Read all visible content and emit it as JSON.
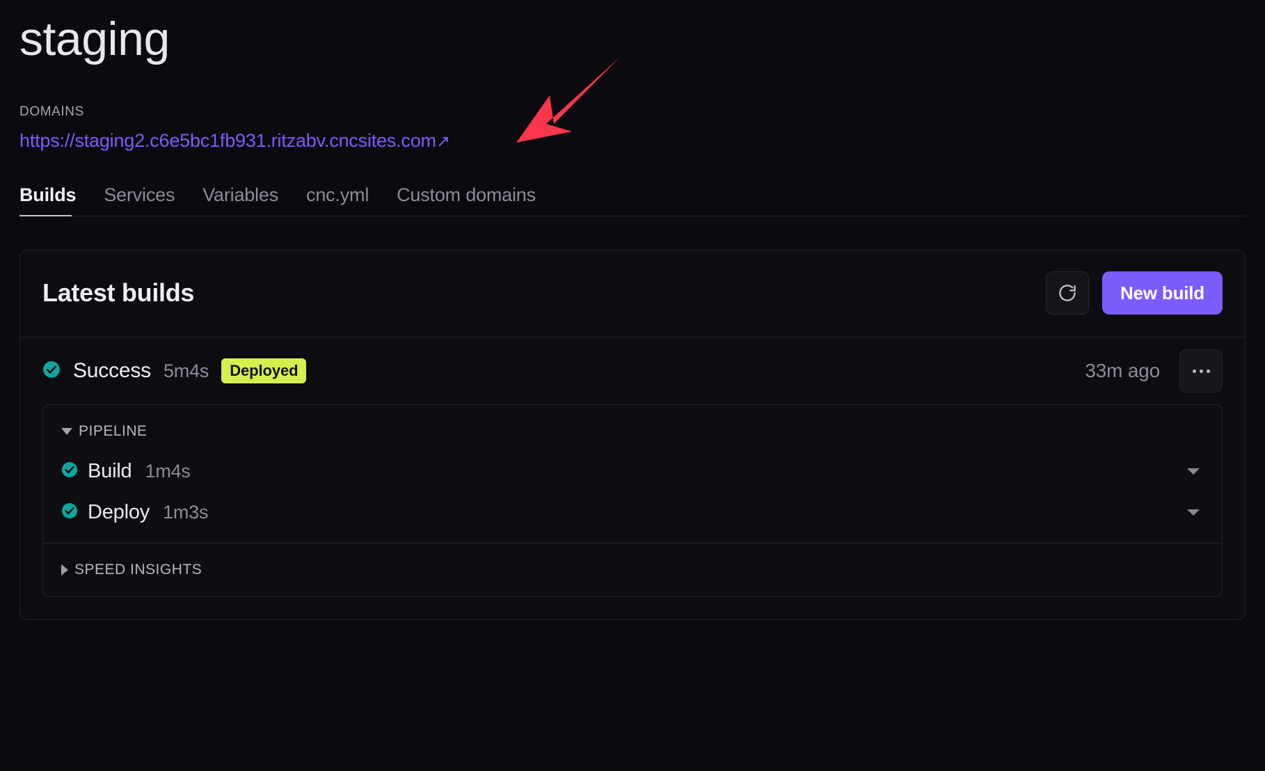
{
  "header": {
    "title": "staging",
    "domains_label": "DOMAINS",
    "domain_url": "https://staging2.c6e5bc1fb931.ritzabv.cncsites.com",
    "external_link_icon": "↗"
  },
  "tabs": [
    {
      "label": "Builds",
      "active": true
    },
    {
      "label": "Services",
      "active": false
    },
    {
      "label": "Variables",
      "active": false
    },
    {
      "label": "cnc.yml",
      "active": false
    },
    {
      "label": "Custom domains",
      "active": false
    }
  ],
  "card": {
    "title": "Latest builds",
    "refresh_icon": "refresh-icon",
    "new_build_label": "New build"
  },
  "build": {
    "status_icon": "check-circle-icon",
    "status": "Success",
    "duration": "5m4s",
    "badge": "Deployed",
    "timestamp": "33m ago",
    "overflow_icon": "ellipsis-icon",
    "pipeline": {
      "label": "PIPELINE",
      "expanded": true,
      "caret_icon": "caret-down-icon",
      "stages": [
        {
          "status_icon": "check-circle-icon",
          "name": "Build",
          "duration": "1m4s",
          "expand_icon": "chevron-down-icon"
        },
        {
          "status_icon": "check-circle-icon",
          "name": "Deploy",
          "duration": "1m3s",
          "expand_icon": "chevron-down-icon"
        }
      ]
    },
    "speed_insights": {
      "label": "SPEED INSIGHTS",
      "expanded": false,
      "caret_icon": "caret-right-icon"
    }
  },
  "annotation": {
    "arrow_color": "#f9364a",
    "arrow_name": "red-pointer-arrow"
  },
  "colors": {
    "accent": "#7c5cfa",
    "success": "#0fa5a0",
    "badge": "#d4f04f",
    "background": "#0b0a0e"
  }
}
